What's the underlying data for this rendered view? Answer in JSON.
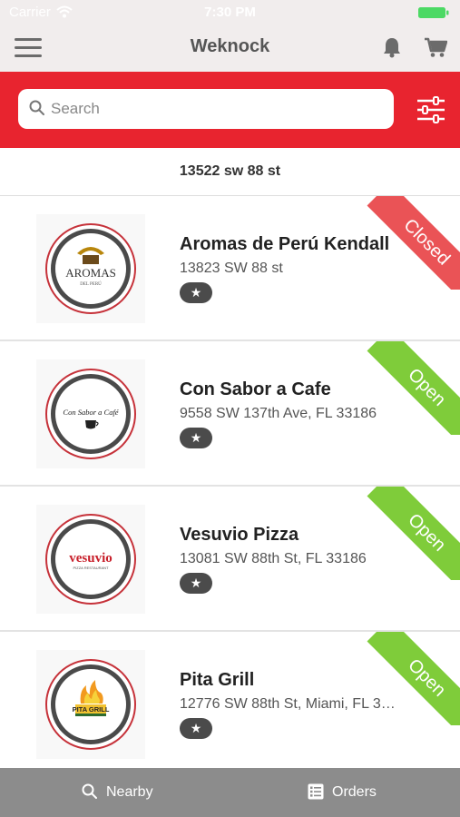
{
  "status_bar": {
    "carrier": "Carrier",
    "time": "7:30 PM"
  },
  "nav": {
    "title": "Weknock",
    "menu_icon": "hamburger-menu-icon",
    "bell_icon": "bell-icon",
    "cart_icon": "cart-icon"
  },
  "search": {
    "placeholder": "Search",
    "value": "",
    "filter_icon": "sliders-filter-icon"
  },
  "location": {
    "address": "13522 sw 88 st"
  },
  "restaurants": [
    {
      "name": "Aromas de Perú Kendall",
      "address": "13823 SW 88 st",
      "status": "Closed",
      "rating_icon": "★",
      "logo_text": "AROMAS",
      "logo_sub": "DEL PERÚ"
    },
    {
      "name": "Con Sabor a Cafe",
      "address": "9558 SW 137th Ave, FL 33186",
      "status": "Open",
      "rating_icon": "★",
      "logo_text": "Con Sabor a Café"
    },
    {
      "name": "Vesuvio Pizza",
      "address": "13081 SW 88th St, FL 33186",
      "status": "Open",
      "rating_icon": "★",
      "logo_text": "vesuvio",
      "logo_sub": "PIZZA RESTAURANT"
    },
    {
      "name": "Pita Grill",
      "address": "12776 SW 88th St, Miami, FL 3…",
      "status": "Open",
      "rating_icon": "★",
      "logo_text": "PITA GRILL"
    }
  ],
  "tabbar": {
    "nearby_label": "Nearby",
    "orders_label": "Orders"
  },
  "colors": {
    "brand_red": "#e8242f",
    "closed": "#ea5356",
    "open": "#7fcc3a",
    "tabbar": "#8c8c8c"
  }
}
